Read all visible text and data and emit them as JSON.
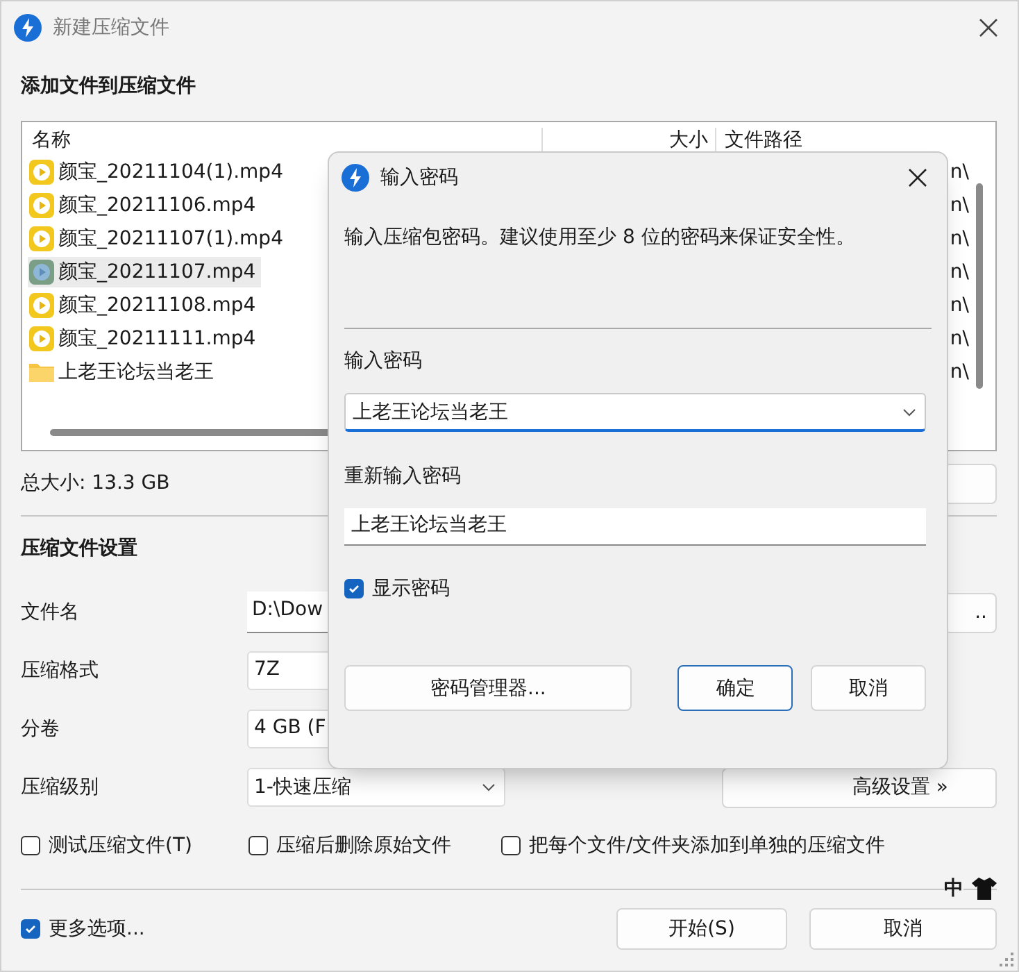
{
  "window": {
    "title": "新建压缩文件"
  },
  "files_section": {
    "heading": "添加文件到压缩文件",
    "columns": [
      "名称",
      "大小",
      "文件路径"
    ],
    "files": [
      {
        "name": "颜宝_20211104(1).mp4",
        "kind": "video",
        "path": "n\\",
        "selected": false
      },
      {
        "name": "颜宝_20211106.mp4",
        "kind": "video",
        "path": "n\\",
        "selected": false
      },
      {
        "name": "颜宝_20211107(1).mp4",
        "kind": "video",
        "path": "n\\",
        "selected": false
      },
      {
        "name": "颜宝_20211107.mp4",
        "kind": "video",
        "path": "n\\",
        "selected": true
      },
      {
        "name": "颜宝_20211108.mp4",
        "kind": "video",
        "path": "n\\",
        "selected": false
      },
      {
        "name": "颜宝_20211111.mp4",
        "kind": "video",
        "path": "n\\",
        "selected": false
      },
      {
        "name": "上老王论坛当老王",
        "kind": "folder",
        "path": "n\\",
        "selected": false
      }
    ]
  },
  "total_size": "总大小: 13.3 GB",
  "settings": {
    "heading": "压缩文件设置",
    "fields": [
      {
        "label": "文件名",
        "value": "D:\\Dow",
        "kind": "text"
      },
      {
        "label": "压缩格式",
        "value": "7Z",
        "kind": "select"
      },
      {
        "label": "分卷",
        "value": "4 GB (F",
        "kind": "select"
      },
      {
        "label": "压缩级别",
        "value": "1-快速压缩",
        "kind": "dropdown"
      }
    ],
    "browse_button": "..",
    "advanced_button": "高级设置 »"
  },
  "options": [
    {
      "label": "测试压缩文件(T)",
      "checked": false
    },
    {
      "label": "压缩后删除原始文件",
      "checked": false
    },
    {
      "label": "把每个文件/文件夹添加到单独的压缩文件",
      "checked": false
    }
  ],
  "more_options": {
    "label": "更多选项...",
    "checked": true
  },
  "ime_indicator": "中",
  "buttons": [
    "开始(S)",
    "取消"
  ],
  "password_dialog": {
    "title": "输入密码",
    "description": "输入压缩包密码。建议使用至少 8 位的密码来保证安全性。",
    "password_label": "输入密码",
    "password_value": "上老王论坛当老王",
    "confirm_label": "重新输入密码",
    "confirm_value": "上老王论坛当老王",
    "show_password": {
      "label": "显示密码",
      "checked": true
    },
    "buttons": [
      {
        "label": "密码管理器...",
        "focused": false
      },
      {
        "label": "确定",
        "focused": true
      },
      {
        "label": "取消",
        "focused": false
      }
    ]
  }
}
